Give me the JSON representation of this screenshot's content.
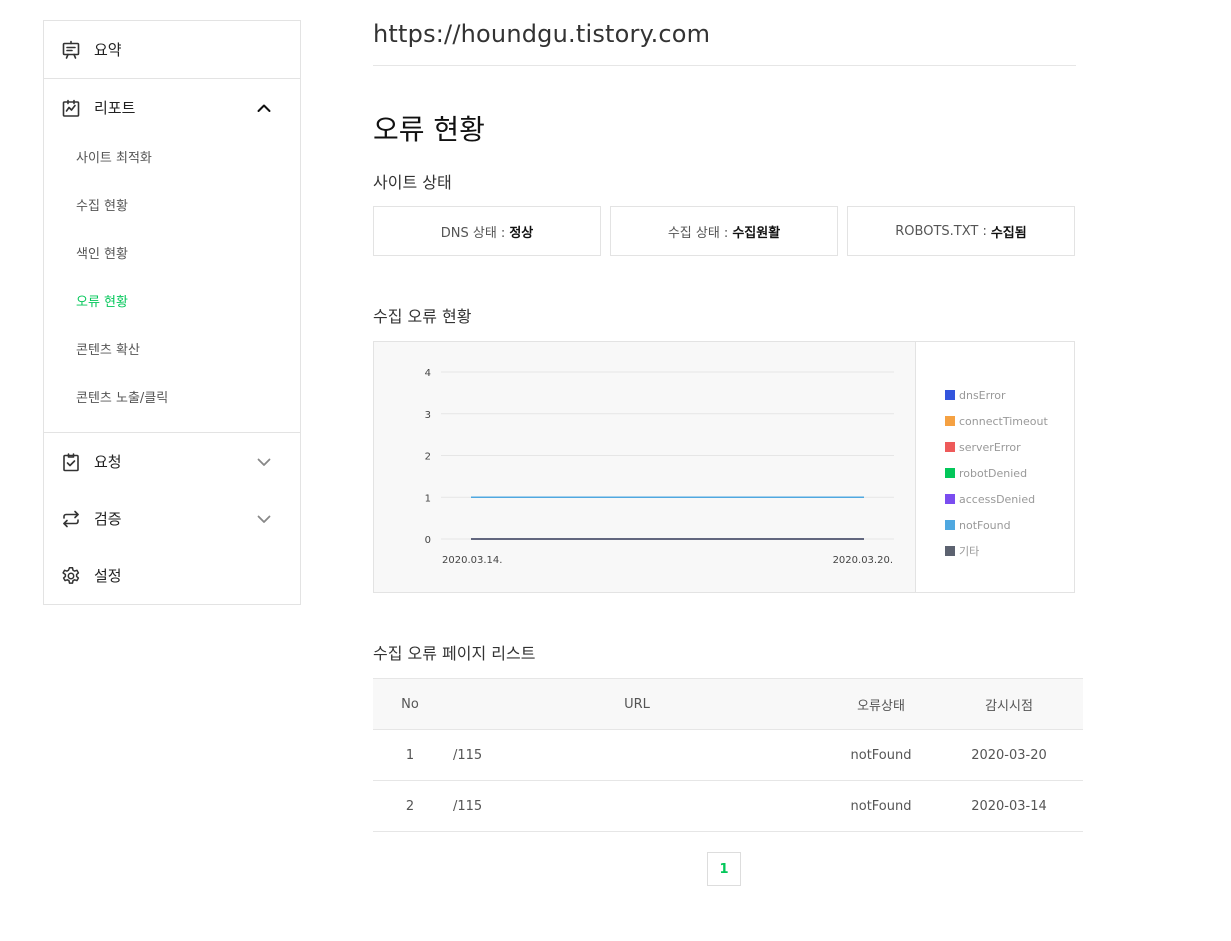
{
  "sidebar": {
    "summary": {
      "label": "요약",
      "icon": "presentation-icon"
    },
    "report": {
      "label": "리포트",
      "icon": "report-chart-icon",
      "items": [
        {
          "label": "사이트 최적화"
        },
        {
          "label": "수집 현황"
        },
        {
          "label": "색인 현황"
        },
        {
          "label": "오류 현황",
          "active": true
        },
        {
          "label": "콘텐츠 확산"
        },
        {
          "label": "콘텐츠 노출/클릭"
        }
      ]
    },
    "request": {
      "label": "요청",
      "icon": "clipboard-check-icon"
    },
    "verify": {
      "label": "검증",
      "icon": "repeat-arrows-icon"
    },
    "settings": {
      "label": "설정",
      "icon": "gear-icon"
    }
  },
  "site_url": "https://houndgu.tistory.com",
  "page_title": "오류 현황",
  "site_status": {
    "title": "사이트 상태",
    "dns": {
      "label": "DNS 상태 :",
      "value": "정상"
    },
    "crawl": {
      "label": "수집 상태 :",
      "value": "수집원활"
    },
    "robots": {
      "label": "ROBOTS.TXT :",
      "value": "수집됨"
    }
  },
  "crawl_error_title": "수집 오류 현황",
  "chart_data": {
    "type": "line",
    "title": "",
    "x": [
      "2020.03.14.",
      "2020.03.20."
    ],
    "ylim": [
      0,
      4
    ],
    "yticks": [
      "0",
      "1",
      "2",
      "3",
      "4"
    ],
    "grid": true,
    "legend_position": "right",
    "series": [
      {
        "name": "dnsError",
        "color": "#3355dd",
        "values": [
          0,
          0
        ]
      },
      {
        "name": "connectTimeout",
        "color": "#f5a142",
        "values": [
          0,
          0
        ]
      },
      {
        "name": "serverError",
        "color": "#ee5a5a",
        "values": [
          0,
          0
        ]
      },
      {
        "name": "robotDenied",
        "color": "#03c75a",
        "values": [
          0,
          0
        ]
      },
      {
        "name": "accessDenied",
        "color": "#7a4df0",
        "values": [
          0,
          0
        ]
      },
      {
        "name": "notFound",
        "color": "#4fa8e0",
        "values": [
          1,
          1
        ]
      },
      {
        "name": "기타",
        "color": "#5c6270",
        "values": [
          0,
          0
        ]
      }
    ]
  },
  "error_list": {
    "title": "수집 오류 페이지 리스트",
    "headers": {
      "no": "No",
      "url": "URL",
      "status": "오류상태",
      "date": "감시시점"
    },
    "rows": [
      {
        "no": "1",
        "url": "/115",
        "status": "notFound",
        "date": "2020-03-20"
      },
      {
        "no": "2",
        "url": "/115",
        "status": "notFound",
        "date": "2020-03-14"
      }
    ]
  },
  "pagination": {
    "current": "1"
  }
}
